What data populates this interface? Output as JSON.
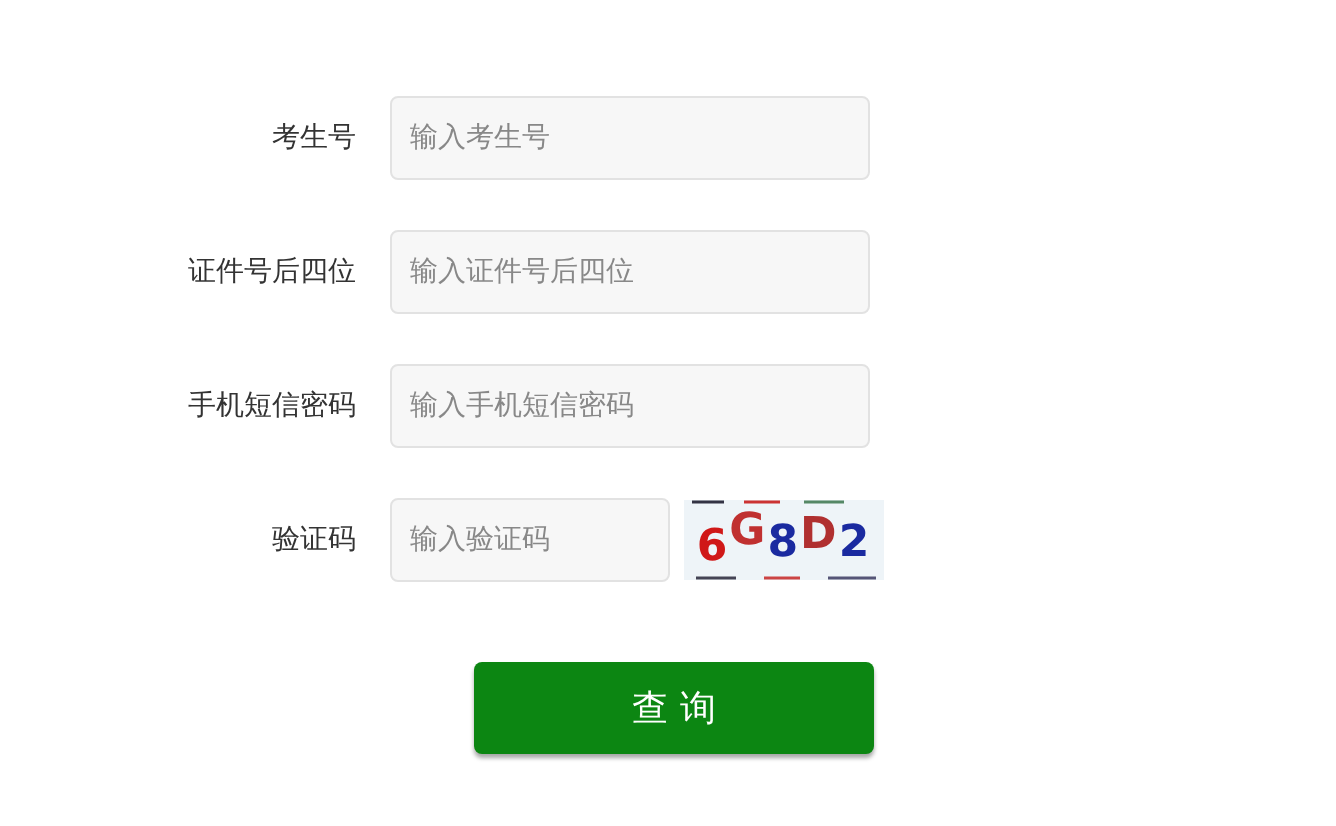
{
  "fields": [
    {
      "label": "考生号",
      "placeholder": "输入考生号",
      "kind": "text"
    },
    {
      "label": "证件号后四位",
      "placeholder": "输入证件号后四位",
      "kind": "text"
    },
    {
      "label": "手机短信密码",
      "placeholder": "输入手机短信密码",
      "kind": "text"
    },
    {
      "label": "验证码",
      "placeholder": "输入验证码",
      "kind": "captcha",
      "captcha": "6G8D2"
    }
  ],
  "submit": "查 询"
}
